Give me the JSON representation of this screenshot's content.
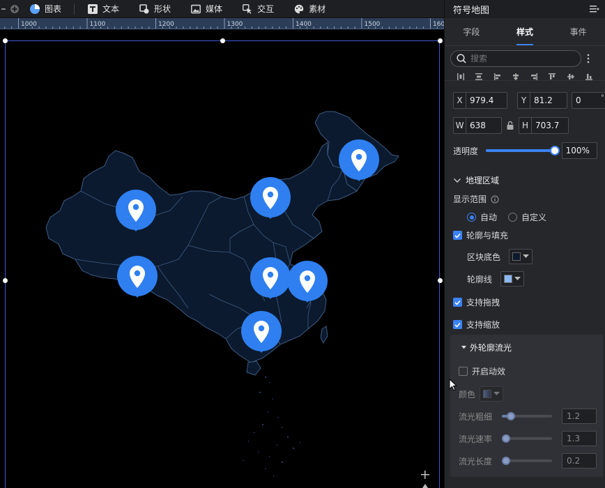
{
  "toolbar": {
    "items": [
      {
        "label": "图表",
        "icon": "pie-chart-icon"
      },
      {
        "label": "文本",
        "icon": "text-icon"
      },
      {
        "label": "形状",
        "icon": "shape-icon"
      },
      {
        "label": "媒体",
        "icon": "image-icon"
      },
      {
        "label": "交互",
        "icon": "cursor-icon"
      },
      {
        "label": "素材",
        "icon": "palette-icon"
      }
    ]
  },
  "ruler": {
    "ticks": [
      "1000",
      "1100",
      "1200",
      "1300",
      "1400",
      "1500",
      "1600"
    ]
  },
  "panel": {
    "title": "符号地图",
    "tabs": [
      "字段",
      "样式",
      "事件"
    ],
    "active_tab": "样式",
    "search_placeholder": "搜索",
    "position": {
      "x_label": "X",
      "x": "979.4",
      "y_label": "Y",
      "y": "81.2",
      "rotation": "0",
      "rotation_unit": "°"
    },
    "size": {
      "w_label": "W",
      "w": "638",
      "h_label": "H",
      "h": "703.7"
    },
    "opacity": {
      "label": "透明度",
      "value": "100%",
      "fraction": 1.0
    },
    "section_geo": "地理区域",
    "display_range": {
      "label": "显示范围",
      "options": [
        "自动",
        "自定义"
      ],
      "selected": "自动"
    },
    "outline_fill": {
      "label": "轮廓与填充",
      "checked": true
    },
    "block_color": {
      "label": "区块底色",
      "color": "#0d1a2e"
    },
    "outline_color": {
      "label": "轮廓线",
      "color": "#8ab8f0"
    },
    "drag": {
      "label": "支持拖拽",
      "checked": true
    },
    "zoom": {
      "label": "支持缩放",
      "checked": true
    },
    "glow": {
      "title": "外轮廓流光",
      "enable": {
        "label": "开启动效",
        "checked": false
      },
      "color_label": "颜色",
      "thickness": {
        "label": "流光粗细",
        "value": "1.2",
        "fraction": 0.12
      },
      "speed": {
        "label": "流光速率",
        "value": "1.3",
        "fraction": 0.0
      },
      "length": {
        "label": "流光长度",
        "value": "0.2",
        "fraction": 0.0
      }
    }
  },
  "colors": {
    "accent": "#3b82f6",
    "pin": "#2f7ff0",
    "map_fill": "#0b1a2e",
    "map_line": "#3f5c85"
  }
}
